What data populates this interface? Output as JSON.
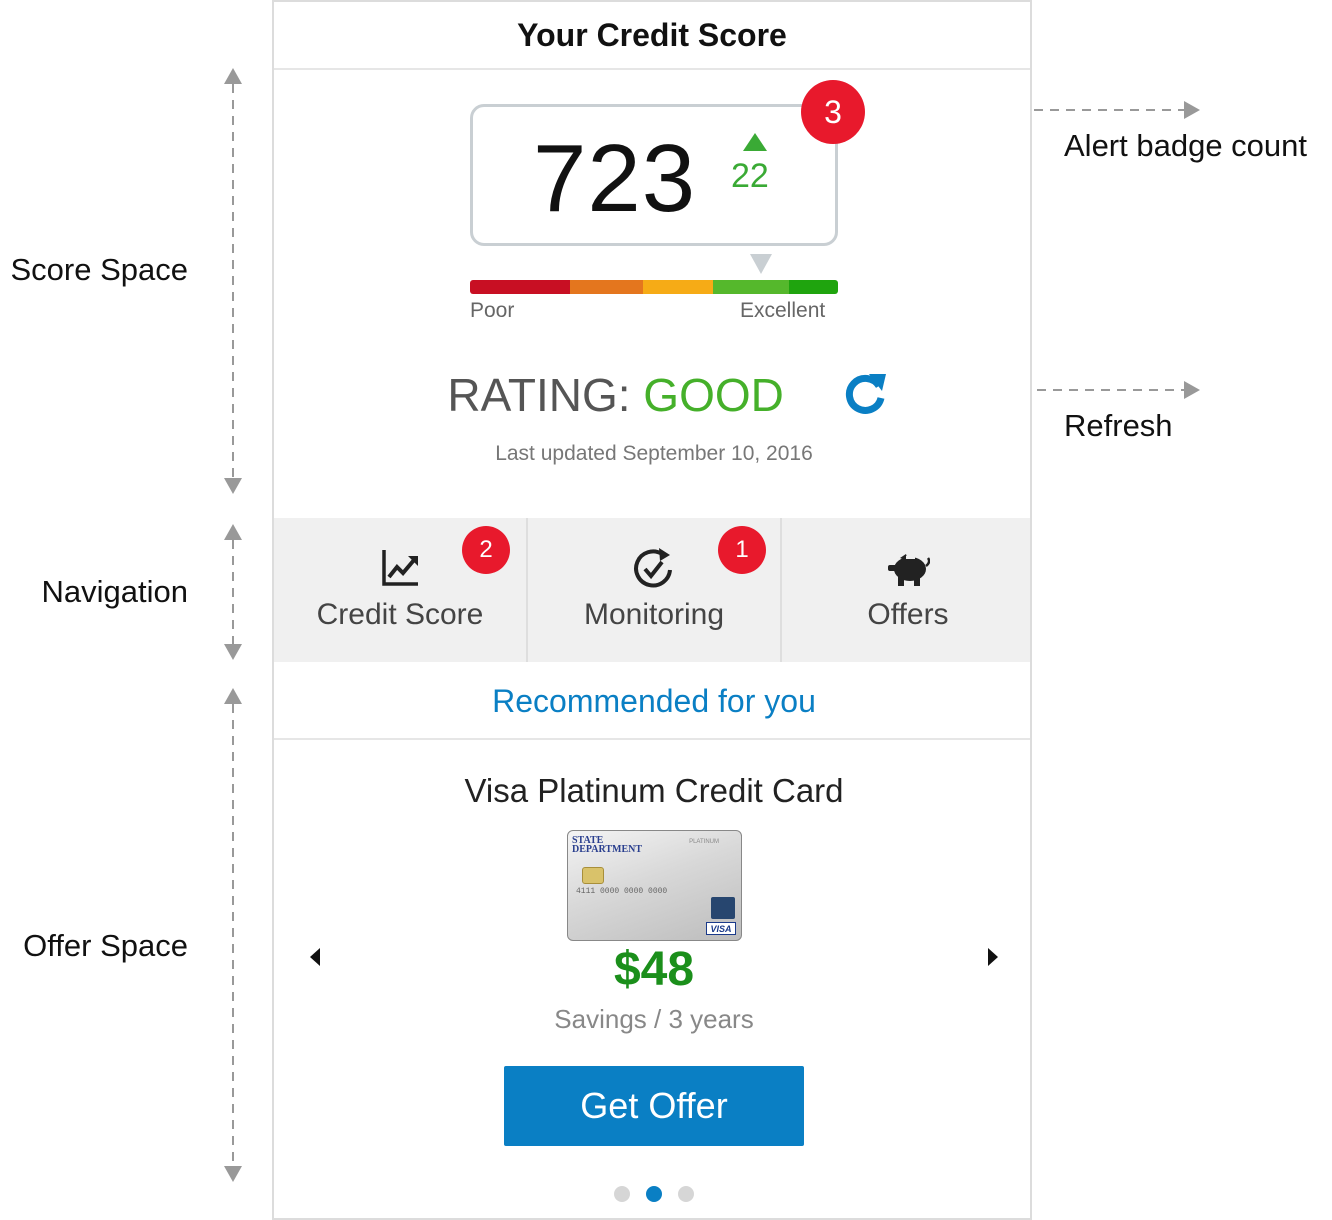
{
  "header": {
    "title": "Your Credit Score"
  },
  "annotations": {
    "sections": [
      "Score Space",
      "Navigation",
      "Offer Space"
    ],
    "callouts": {
      "alert_badge": "Alert badge count",
      "refresh": "Refresh"
    }
  },
  "score": {
    "value": "723",
    "delta": "22",
    "alert_count": "3",
    "gauge_min_label": "Poor",
    "gauge_max_label": "Excellent",
    "gauge_colors": [
      "#c80f23",
      "#e4761e",
      "#f6ab16",
      "#55b82c",
      "#1fa40e"
    ],
    "rating_prefix": "RATING:",
    "rating_value": "GOOD",
    "last_updated": "Last updated September 10, 2016"
  },
  "nav": {
    "items": [
      {
        "label": "Credit Score",
        "badge": "2",
        "icon": "chart-icon"
      },
      {
        "label": "Monitoring",
        "badge": "1",
        "icon": "monitoring-icon"
      },
      {
        "label": "Offers",
        "badge": "",
        "icon": "piggy-bank-icon"
      }
    ]
  },
  "offers": {
    "heading": "Recommended for you",
    "title": "Visa Platinum Credit Card",
    "savings": "$48",
    "savings_period": "Savings / 3 years",
    "cta": "Get Offer",
    "card": {
      "issuer_line1": "STATE",
      "issuer_line2": "DEPARTMENT",
      "number": "4111  0000  0000  0000",
      "brand": "VISA",
      "tier": "PLATINUM"
    },
    "carousel": {
      "current": 2,
      "total": 3
    }
  },
  "colors": {
    "accent": "#0a7fc4",
    "positive": "#45b02a",
    "badge": "#e8192c",
    "savings": "#1b8f1b"
  }
}
